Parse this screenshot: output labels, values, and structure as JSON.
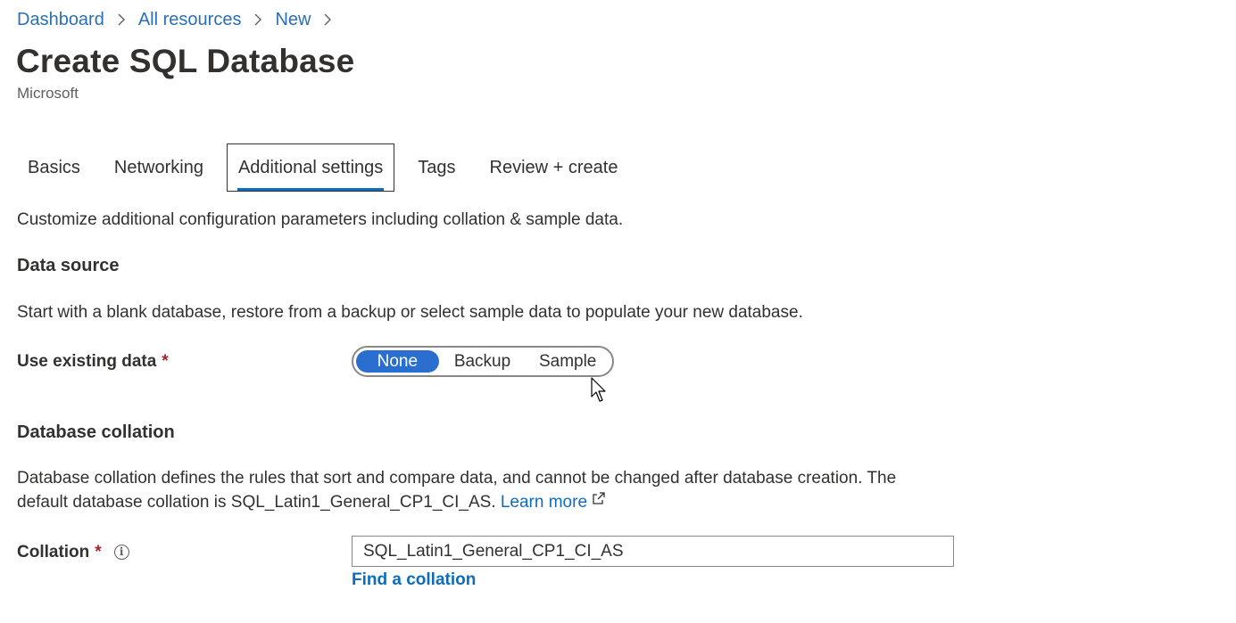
{
  "breadcrumb": [
    "Dashboard",
    "All resources",
    "New"
  ],
  "page": {
    "title": "Create SQL Database",
    "subtitle": "Microsoft"
  },
  "tabs": [
    {
      "label": "Basics",
      "active": false
    },
    {
      "label": "Networking",
      "active": false
    },
    {
      "label": "Additional settings",
      "active": true
    },
    {
      "label": "Tags",
      "active": false
    },
    {
      "label": "Review + create",
      "active": false
    }
  ],
  "intro": "Customize additional configuration parameters including collation & sample data.",
  "data_source": {
    "heading": "Data source",
    "description": "Start with a blank database, restore from a backup or select sample data to populate your new database.",
    "use_existing_label": "Use existing data",
    "required_mark": "*",
    "options": [
      "None",
      "Backup",
      "Sample"
    ],
    "selected": "None"
  },
  "collation": {
    "heading": "Database collation",
    "description_line1": "Database collation defines the rules that sort and compare data, and cannot be changed after database creation. The",
    "description_line2": "default database collation is SQL_Latin1_General_CP1_CI_AS.",
    "learn_more": "Learn more",
    "label": "Collation",
    "required_mark": "*",
    "value": "SQL_Latin1_General_CP1_CI_AS",
    "find_link": "Find a collation"
  },
  "icons": {
    "breadcrumb_separator": "chevron-right-icon",
    "info": "info-icon",
    "external_link": "external-link-icon",
    "cursor": "mouse-pointer-icon"
  },
  "colors": {
    "accent": "#0f6cbd",
    "toggle_on": "#2a6fd0",
    "required": "#a4262c"
  }
}
